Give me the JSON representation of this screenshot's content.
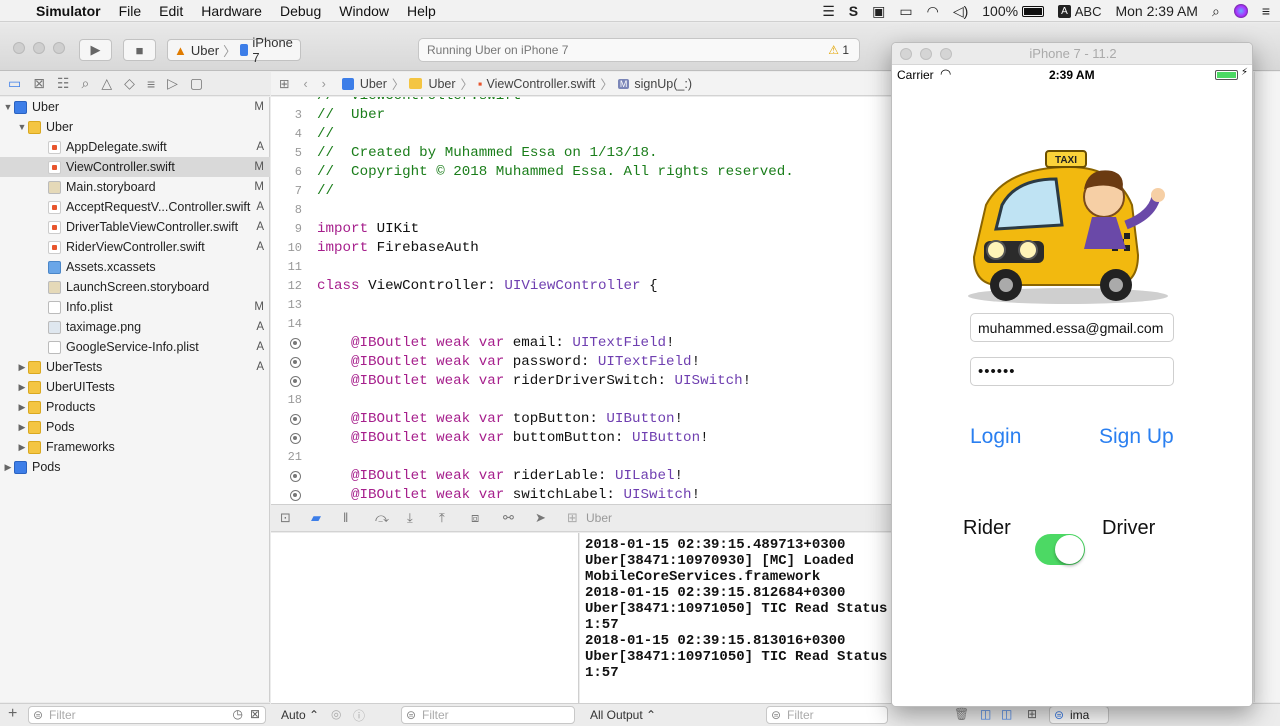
{
  "menubar": {
    "app": "Simulator",
    "items": [
      "File",
      "Edit",
      "Hardware",
      "Debug",
      "Window",
      "Help"
    ],
    "battery": "100%",
    "input_source": "ABC",
    "clock": "Mon 2:39 AM"
  },
  "toolbar": {
    "scheme": "Uber",
    "device": "iPhone 7",
    "status": "Running Uber on iPhone 7",
    "warnings": "1"
  },
  "navigator": {
    "items": [
      {
        "label": "Uber",
        "badge": "M"
      },
      {
        "label": "Uber",
        "badge": ""
      },
      {
        "label": "AppDelegate.swift",
        "badge": "A"
      },
      {
        "label": "ViewController.swift",
        "badge": "M"
      },
      {
        "label": "Main.storyboard",
        "badge": "M"
      },
      {
        "label": "AcceptRequestV...Controller.swift",
        "badge": "A"
      },
      {
        "label": "DriverTableViewController.swift",
        "badge": "A"
      },
      {
        "label": "RiderViewController.swift",
        "badge": "A"
      },
      {
        "label": "Assets.xcassets",
        "badge": ""
      },
      {
        "label": "LaunchScreen.storyboard",
        "badge": ""
      },
      {
        "label": "Info.plist",
        "badge": "M"
      },
      {
        "label": "taximage.png",
        "badge": "A"
      },
      {
        "label": "GoogleService-Info.plist",
        "badge": "A"
      },
      {
        "label": "UberTests",
        "badge": "A"
      },
      {
        "label": "UberUITests",
        "badge": ""
      },
      {
        "label": "Products",
        "badge": ""
      },
      {
        "label": "Pods",
        "badge": ""
      },
      {
        "label": "Frameworks",
        "badge": ""
      },
      {
        "label": "Pods",
        "badge": ""
      }
    ],
    "filter_placeholder": "Filter"
  },
  "jumpbar": {
    "crumbs": [
      "Uber",
      "Uber",
      "ViewController.swift",
      "signUp(_:)"
    ]
  },
  "editor": {
    "lines": [
      {
        "n": "",
        "t": "//  ViewController.swift"
      },
      {
        "n": "3",
        "t": "//  Uber"
      },
      {
        "n": "4",
        "t": "//"
      },
      {
        "n": "5",
        "t": "//  Created by Muhammed Essa on 1/13/18."
      },
      {
        "n": "6",
        "t": "//  Copyright © 2018 Muhammed Essa. All rights reserved."
      },
      {
        "n": "7",
        "t": "//"
      },
      {
        "n": "8",
        "t": ""
      },
      {
        "n": "9",
        "kw": "import",
        "rest": " UIKit"
      },
      {
        "n": "10",
        "kw": "import",
        "rest": " FirebaseAuth"
      },
      {
        "n": "11",
        "t": ""
      },
      {
        "n": "12",
        "kw": "class",
        "rest": " ViewController: ",
        "ty": "UIViewController",
        "tail": " {"
      },
      {
        "n": "13",
        "t": ""
      },
      {
        "n": "14",
        "t": ""
      },
      {
        "n": "",
        "bp": true,
        "ib": "@IBOutlet weak var",
        "rest": " email: ",
        "ty": "UITextField",
        "tail": "!"
      },
      {
        "n": "",
        "bp": true,
        "ib": "@IBOutlet weak var",
        "rest": " password: ",
        "ty": "UITextField",
        "tail": "!"
      },
      {
        "n": "",
        "bp": true,
        "ib": "@IBOutlet weak var",
        "rest": " riderDriverSwitch: ",
        "ty": "UISwitch",
        "tail": "!"
      },
      {
        "n": "18",
        "t": ""
      },
      {
        "n": "",
        "bp": true,
        "ib": "@IBOutlet weak var",
        "rest": " topButton: ",
        "ty": "UIButton",
        "tail": "!"
      },
      {
        "n": "",
        "bp": true,
        "ib": "@IBOutlet weak var",
        "rest": " buttomButton: ",
        "ty": "UIButton",
        "tail": "!"
      },
      {
        "n": "21",
        "t": ""
      },
      {
        "n": "",
        "bp": true,
        "ib": "@IBOutlet weak var",
        "rest": " riderLable: ",
        "ty": "UILabel",
        "tail": "!"
      },
      {
        "n": "",
        "bp": true,
        "ib": "@IBOutlet weak var",
        "rest": " switchLabel: ",
        "ty": "UISwitch",
        "tail": "!"
      }
    ]
  },
  "debug": {
    "target": "Uber",
    "auto_label": "Auto",
    "var_filter_placeholder": "Filter",
    "output_label": "All Output",
    "console_filter_placeholder": "Filter",
    "search_text": "ima"
  },
  "console": {
    "lines": [
      "2018-01-15 02:39:15.489713+0300",
      "Uber[38471:10970930] [MC] Loaded",
      "MobileCoreServices.framework",
      "2018-01-15 02:39:15.812684+0300",
      "Uber[38471:10971050] TIC Read Status",
      "1:57",
      "2018-01-15 02:39:15.813016+0300",
      "Uber[38471:10971050] TIC Read Status",
      "1:57"
    ]
  },
  "simulator": {
    "title": "iPhone 7 - 11.2",
    "carrier": "Carrier",
    "time": "2:39 AM",
    "email_value": "muhammed.essa@gmail.com",
    "password_value": "••••••",
    "login_label": "Login",
    "signup_label": "Sign Up",
    "rider_label": "Rider",
    "driver_label": "Driver",
    "switch_on": true,
    "taxi_sign": "TAXI"
  },
  "colors": {
    "link_blue": "#2a7ff0",
    "switch_green": "#4cd964",
    "comment_green": "#1a7d1a",
    "keyword_purple": "#a61f8c",
    "type_purple": "#6f3fb0"
  }
}
